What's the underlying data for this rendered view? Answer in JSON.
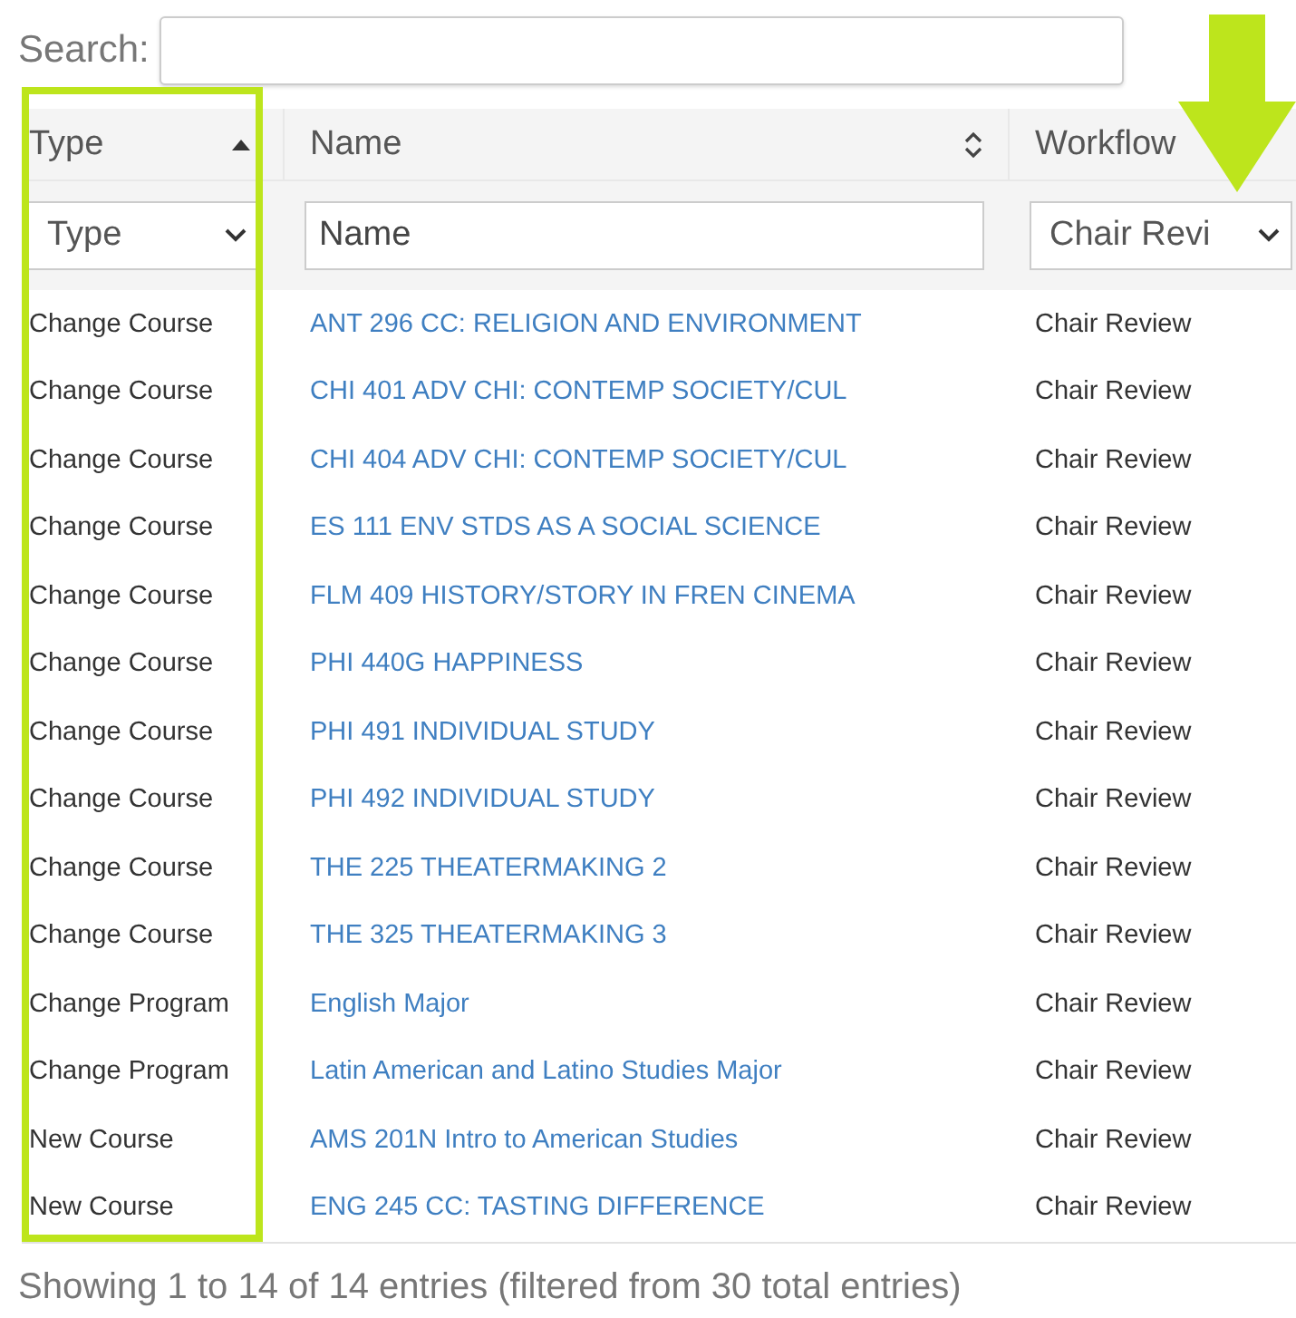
{
  "search": {
    "label": "Search:"
  },
  "columns": [
    {
      "label": "Type",
      "sortable": true,
      "sorted": true
    },
    {
      "label": "Name",
      "sortable": true,
      "sorted": false
    },
    {
      "label": "Workflow",
      "sortable": false,
      "sorted": false
    }
  ],
  "filters": [
    {
      "kind": "select",
      "value": "Type"
    },
    {
      "kind": "input",
      "placeholder": "Name"
    },
    {
      "kind": "select",
      "value": "Chair Revi"
    }
  ],
  "rows": [
    {
      "type": "Change Course",
      "name": "ANT 296 CC: RELIGION AND ENVIRONMENT",
      "workflow": "Chair Review"
    },
    {
      "type": "Change Course",
      "name": "CHI 401 ADV CHI: CONTEMP SOCIETY/CUL",
      "workflow": "Chair Review"
    },
    {
      "type": "Change Course",
      "name": "CHI 404 ADV CHI: CONTEMP SOCIETY/CUL",
      "workflow": "Chair Review"
    },
    {
      "type": "Change Course",
      "name": "ES 111 ENV STDS AS A SOCIAL SCIENCE",
      "workflow": "Chair Review"
    },
    {
      "type": "Change Course",
      "name": "FLM 409 HISTORY/STORY IN FREN CINEMA",
      "workflow": "Chair Review"
    },
    {
      "type": "Change Course",
      "name": "PHI 440G HAPPINESS",
      "workflow": "Chair Review"
    },
    {
      "type": "Change Course",
      "name": "PHI 491 INDIVIDUAL STUDY",
      "workflow": "Chair Review"
    },
    {
      "type": "Change Course",
      "name": "PHI 492 INDIVIDUAL STUDY",
      "workflow": "Chair Review"
    },
    {
      "type": "Change Course",
      "name": "THE 225 THEATERMAKING 2",
      "workflow": "Chair Review"
    },
    {
      "type": "Change Course",
      "name": "THE 325 THEATERMAKING 3",
      "workflow": "Chair Review"
    },
    {
      "type": "Change Program",
      "name": "English Major",
      "workflow": "Chair Review"
    },
    {
      "type": "Change Program",
      "name": "Latin American and Latino Studies Major",
      "workflow": "Chair Review"
    },
    {
      "type": "New Course",
      "name": "AMS 201N Intro to American Studies",
      "workflow": "Chair Review"
    },
    {
      "type": "New Course",
      "name": "ENG 245 CC: TASTING DIFFERENCE",
      "workflow": "Chair Review"
    }
  ],
  "footer": "Showing 1 to 14 of 14 entries (filtered from 30 total entries)"
}
